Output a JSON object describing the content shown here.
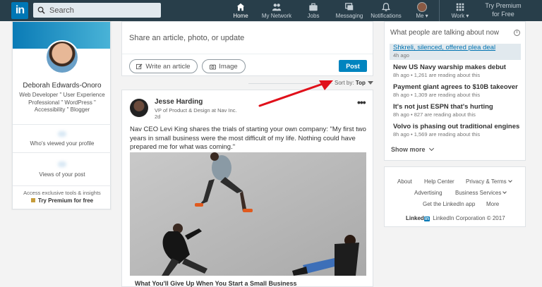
{
  "colors": {
    "nav_bg": "#283e4a",
    "brand_blue": "#0077b5",
    "post_button": "#0084bf",
    "arrow": "#e0101a"
  },
  "nav": {
    "logo_text": "in",
    "search_placeholder": "Search",
    "items": [
      {
        "label": "Home",
        "icon": "home-icon"
      },
      {
        "label": "My Network",
        "icon": "network-icon"
      },
      {
        "label": "Jobs",
        "icon": "briefcase-icon"
      },
      {
        "label": "Messaging",
        "icon": "messaging-icon"
      },
      {
        "label": "Notifications",
        "icon": "bell-icon"
      },
      {
        "label": "Me ▾",
        "icon": "avatar"
      },
      {
        "label": "Work ▾",
        "icon": "grid-icon"
      }
    ],
    "premium_line1": "Try Premium",
    "premium_line2": "for Free"
  },
  "profile": {
    "name": "Deborah Edwards-Onoro",
    "headline": "Web Developer \" User Experience Professional \" WordPress \" Accessibility \" Blogger",
    "stat1": "Who's viewed your profile",
    "stat2": "Views of your post",
    "tools_text": "Access exclusive tools & insights",
    "premium_text": "Try Premium for free"
  },
  "share": {
    "prompt": "Share an article, photo, or update",
    "write_article": "Write an article",
    "image": "Image",
    "post": "Post"
  },
  "sort": {
    "label": "Sort by:",
    "value": "Top"
  },
  "post": {
    "author": "Jesse Harding",
    "author_title": "VP of Product & Design at Nav Inc.",
    "age": "2d",
    "menu": "•••",
    "text": "Nav CEO Levi King shares the trials of starting your own company: \"My first two years in small business were the most difficult of my life. Nothing could have prepared me for what was coming.\"",
    "caption": "What You'll Give Up When You Start a Small Business"
  },
  "trending": {
    "header": "What people are talking about now",
    "items": [
      {
        "title": "Shkreli, silenced, offered plea deal",
        "meta": "4h ago"
      },
      {
        "title": "New US Navy warship makes debut",
        "meta": "8h ago • 1,261 are reading about this"
      },
      {
        "title": "Payment giant agrees to $10B takeover",
        "meta": "8h ago • 1,309 are reading about this"
      },
      {
        "title": "It's not just ESPN that's hurting",
        "meta": "8h ago • 827 are reading about this"
      },
      {
        "title": "Volvo is phasing out traditional engines",
        "meta": "8h ago • 1,569 are reading about this"
      }
    ],
    "show_more": "Show more"
  },
  "footer": {
    "about": "About",
    "help": "Help Center",
    "privacy": "Privacy & Terms",
    "advertising": "Advertising",
    "business": "Business Services",
    "app": "Get the LinkedIn app",
    "more": "More",
    "brand_word": "Linked",
    "brand_in": "in",
    "copyright": "LinkedIn Corporation © 2017"
  }
}
